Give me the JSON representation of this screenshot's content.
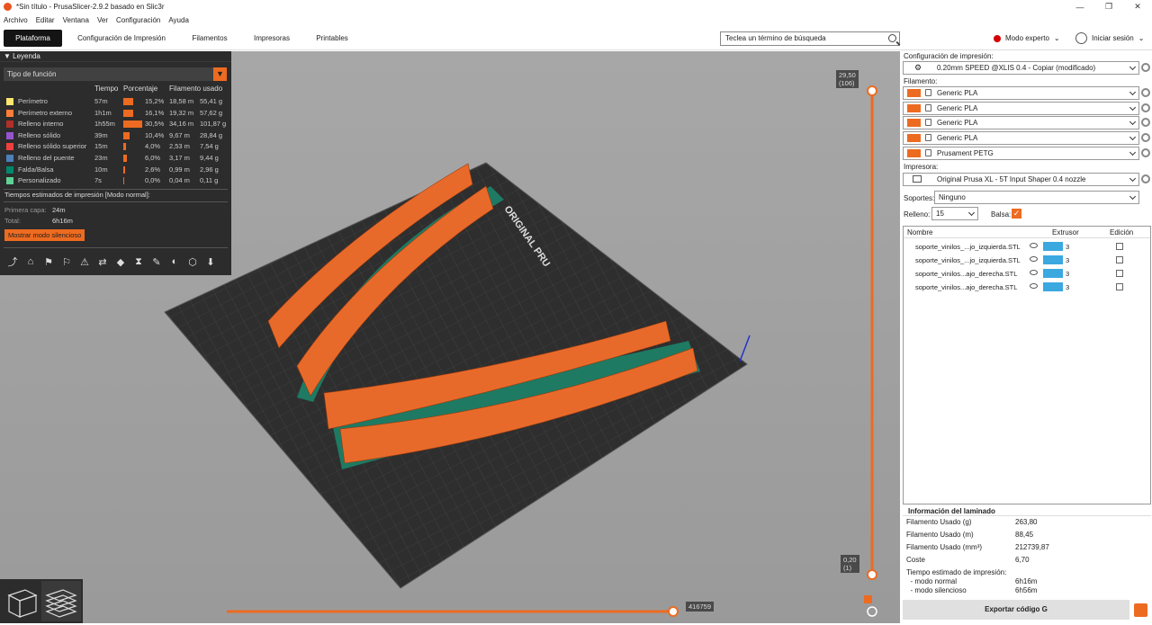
{
  "window": {
    "title": "*Sin título - PrusaSlicer-2.9.2 basado en Slic3r",
    "buttons": [
      "—",
      "❐",
      "✕"
    ]
  },
  "menu": [
    "Archivo",
    "Editar",
    "Ventana",
    "Ver",
    "Configuración",
    "Ayuda"
  ],
  "tabs": [
    "Plataforma",
    "Configuración de Impresión",
    "Filamentos",
    "Impresoras",
    "Printables"
  ],
  "search": {
    "placeholder": "Teclea un término de búsqueda"
  },
  "mode": "Modo experto",
  "login": "Iniciar sesión",
  "legend": {
    "title": "Leyenda",
    "view_type": "Tipo de función",
    "columns": {
      "time": "Tiempo",
      "percent": "Porcentaje",
      "filament": "Filamento usado"
    },
    "rows": [
      {
        "name": "Perímetro",
        "time": "57m",
        "pct": "15,2%",
        "fraction": 0.152,
        "m": "18,58 m",
        "g": "55,41 g",
        "color": "#ffe66e"
      },
      {
        "name": "Perímetro externo",
        "time": "1h1m",
        "pct": "16,1%",
        "fraction": 0.161,
        "m": "19,32 m",
        "g": "57,62 g",
        "color": "#ff7d38"
      },
      {
        "name": "Relleno interno",
        "time": "1h55m",
        "pct": "30,5%",
        "fraction": 0.305,
        "m": "34,16 m",
        "g": "101,87 g",
        "color": "#b03029"
      },
      {
        "name": "Relleno sólido",
        "time": "39m",
        "pct": "10,4%",
        "fraction": 0.104,
        "m": "9,67 m",
        "g": "28,84 g",
        "color": "#9654cc"
      },
      {
        "name": "Relleno sólido superior",
        "time": "15m",
        "pct": "4,0%",
        "fraction": 0.04,
        "m": "2,53 m",
        "g": "7,54 g",
        "color": "#f04040"
      },
      {
        "name": "Relleno del puente",
        "time": "23m",
        "pct": "6,0%",
        "fraction": 0.06,
        "m": "3,17 m",
        "g": "9,44 g",
        "color": "#4d80ba"
      },
      {
        "name": "Falda/Balsa",
        "time": "10m",
        "pct": "2,6%",
        "fraction": 0.026,
        "m": "0,99 m",
        "g": "2,96 g",
        "color": "#00876e"
      },
      {
        "name": "Personalizado",
        "time": "7s",
        "pct": "0,0%",
        "fraction": 0.0,
        "m": "0,04 m",
        "g": "0,11 g",
        "color": "#5ed194"
      }
    ],
    "estimated_title": "Tiempos estimados de impresión [Modo normal]:",
    "first_layer_label": "Primera capa:",
    "first_layer_value": "24m",
    "total_label": "Total:",
    "total_value": "6h16m",
    "silent_button": "Mostrar modo silencioso"
  },
  "slider": {
    "top_value": "29,50",
    "top_layer": "(106)",
    "bottom_value": "0,20",
    "bottom_layer": "(1)",
    "h_value": "416759"
  },
  "right": {
    "print_settings_label": "Configuración de impresión:",
    "print_settings_value": "0.20mm SPEED @XLIS 0.4 - Copiar (modificado)",
    "filament_label": "Filamento:",
    "filaments": [
      "Generic PLA",
      "Generic PLA",
      "Generic PLA",
      "Generic PLA",
      "Prusament PETG"
    ],
    "printer_label": "Impresora:",
    "printer_value": "Original Prusa XL - 5T Input Shaper 0.4 nozzle",
    "supports_label": "Soportes:",
    "supports_value": "Ninguno",
    "infill_label": "Relleno:",
    "infill_value": "15",
    "raft_label": "Balsa:",
    "objects_header": {
      "name": "Nombre",
      "extruder": "Extrusor",
      "edit": "Edición"
    },
    "objects": [
      {
        "name": "soporte_vinilos_...jo_izquierda.STL",
        "extruder": "3"
      },
      {
        "name": "soporte_vinilos_...jo_izquierda.STL",
        "extruder": "3"
      },
      {
        "name": "soporte_vinilos...ajo_derecha.STL",
        "extruder": "3"
      },
      {
        "name": "soporte_vinilos...ajo_derecha.STL",
        "extruder": "3"
      }
    ],
    "info_title": "Información del laminado",
    "info": [
      {
        "label": "Filamento Usado (g)",
        "value": "263,80"
      },
      {
        "label": "Filamento Usado (m)",
        "value": "88,45"
      },
      {
        "label": "Filamento Usado (mm³)",
        "value": "212739,87"
      },
      {
        "label": "Coste",
        "value": "6,70"
      },
      {
        "label": "Tiempo estimado de impresión:",
        "value": ""
      },
      {
        "label": "  - modo normal",
        "value": "6h16m"
      },
      {
        "label": "  - modo silencioso",
        "value": "6h56m"
      }
    ],
    "export_button": "Exportar código G"
  },
  "colors": {
    "accent": "#ed6b21",
    "extruder": "#3ba8e0",
    "skirt": "#00876e"
  }
}
